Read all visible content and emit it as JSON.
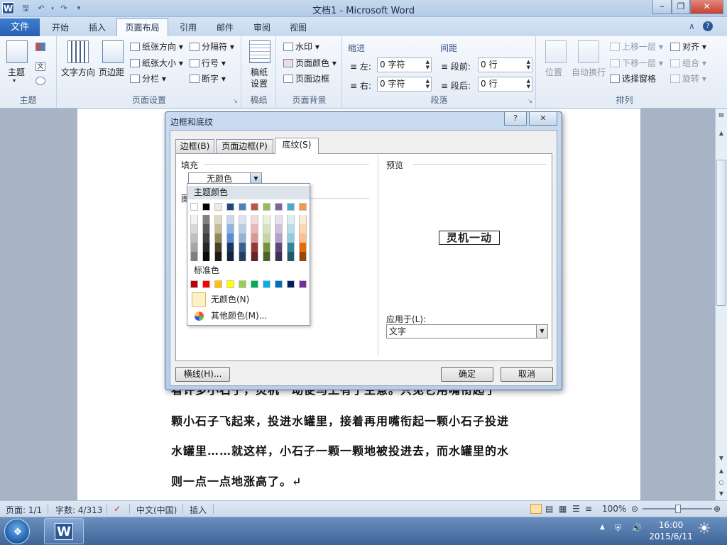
{
  "window": {
    "title": "文档1 - Microsoft Word",
    "app_icon": "W"
  },
  "ribbon": {
    "file_tab": "文件",
    "tabs": [
      "开始",
      "插入",
      "页面布局",
      "引用",
      "邮件",
      "审阅",
      "视图"
    ],
    "active_tab": "页面布局",
    "theme_group": {
      "label": "主题",
      "themes": "主题"
    },
    "page_setup": {
      "label": "页面设置",
      "text_direction": "文字方向",
      "margins": "页边距",
      "orientation": "纸张方向",
      "size": "纸张大小",
      "columns": "分栏",
      "breaks": "分隔符",
      "line_numbers": "行号",
      "hyphenation": "断字"
    },
    "draft_group": {
      "label": "稿纸",
      "draft_setup_1": "稿纸",
      "draft_setup_2": "设置"
    },
    "page_background": {
      "label": "页面背景",
      "watermark": "水印",
      "page_color": "页面颜色",
      "page_borders": "页面边框"
    },
    "paragraph": {
      "label": "段落",
      "indent_label": "缩进",
      "spacing_label": "间距",
      "left_label": "左:",
      "left_value": "0 字符",
      "right_label": "右:",
      "right_value": "0 字符",
      "before_label": "段前:",
      "before_value": "0 行",
      "after_label": "段后:",
      "after_value": "0 行"
    },
    "arrange": {
      "label": "排列",
      "position": "位置",
      "wrap_text": "自动换行",
      "bring_forward": "上移一层",
      "send_backward": "下移一层",
      "selection_pane": "选择窗格",
      "align": "对齐",
      "group": "组合",
      "rotate": "旋转"
    }
  },
  "document": {
    "lines": [
      "看许多小石子，灵机一动便马上有了主意。只见它用嘴衔起了",
      "颗小石子飞起来，投进水罐里，接着再用嘴衔起一颗小石子投进",
      "水罐里……就这样，小石子一颗一颗地被投进去，而水罐里的水",
      "则一点一点地涨高了。↵"
    ]
  },
  "dialog": {
    "title": "边框和底纹",
    "help": "?",
    "tabs": [
      "边框(B)",
      "页面边框(P)",
      "底纹(S)"
    ],
    "active_tab": "底纹(S)",
    "fill_label": "填充",
    "fill_value": "无颜色",
    "pattern_label": "图",
    "preview_label": "预览",
    "preview_text": "灵机一动",
    "apply_to_label": "应用于(L):",
    "apply_to_value": "文字",
    "horizontal_line_button": "横线(H)...",
    "ok_button": "确定",
    "cancel_button": "取消"
  },
  "color_popup": {
    "theme_colors_label": "主题颜色",
    "standard_colors_label": "标准色",
    "no_color": "无颜色(N)",
    "more_colors": "其他颜色(M)...",
    "theme_top": [
      "#ffffff",
      "#000000",
      "#eeece1",
      "#1f497d",
      "#4f81bd",
      "#c0504d",
      "#9bbb59",
      "#8064a2",
      "#4bacc6",
      "#f79646"
    ],
    "theme_shades": [
      [
        "#f2f2f2",
        "#d8d8d8",
        "#bfbfbf",
        "#a5a5a5",
        "#7f7f7f"
      ],
      [
        "#7f7f7f",
        "#595959",
        "#3f3f3f",
        "#262626",
        "#0c0c0c"
      ],
      [
        "#ddd9c3",
        "#c4bd97",
        "#938953",
        "#494429",
        "#1d1b10"
      ],
      [
        "#c6d9f0",
        "#8db3e2",
        "#548dd4",
        "#17365d",
        "#0f243e"
      ],
      [
        "#dbe5f1",
        "#b8cce4",
        "#95b3d7",
        "#366092",
        "#244061"
      ],
      [
        "#f2dcdb",
        "#e5b9b7",
        "#d99694",
        "#953734",
        "#632423"
      ],
      [
        "#ebf1dd",
        "#d7e3bc",
        "#c3d69b",
        "#76923c",
        "#4f6128"
      ],
      [
        "#e5e0ec",
        "#ccc1d9",
        "#b2a2c7",
        "#5f497a",
        "#3f3151"
      ],
      [
        "#dbeef3",
        "#b7dde8",
        "#92cddc",
        "#31859b",
        "#205867"
      ],
      [
        "#fdeada",
        "#fbd5b5",
        "#fac08f",
        "#e36c09",
        "#974806"
      ]
    ],
    "standard": [
      "#c00000",
      "#ff0000",
      "#ffc000",
      "#ffff00",
      "#92d050",
      "#00b050",
      "#00b0f0",
      "#0070c0",
      "#002060",
      "#7030a0"
    ]
  },
  "statusbar": {
    "page": "页面: 1/1",
    "words": "字数: 4/313",
    "language": "中文(中国)",
    "mode": "插入",
    "zoom": "100%"
  },
  "taskbar": {
    "time": "16:00",
    "date": "2015/6/11"
  }
}
